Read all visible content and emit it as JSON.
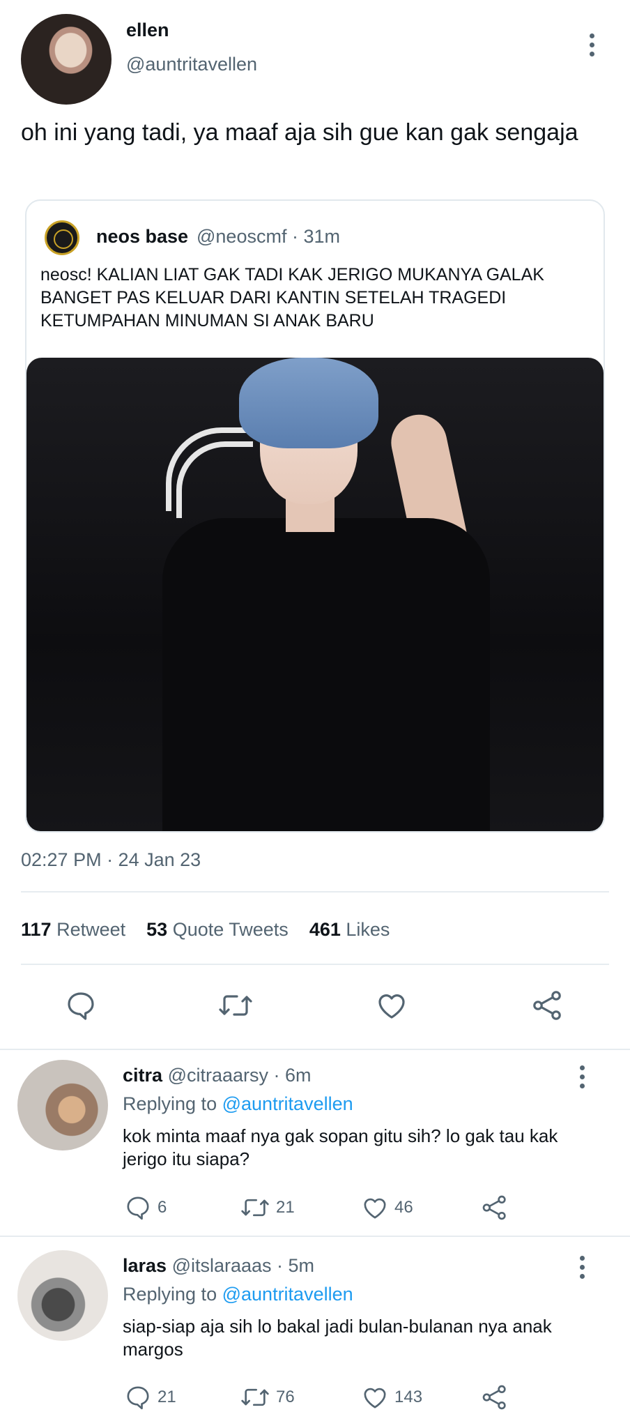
{
  "tweet": {
    "author_name": "ellen",
    "author_handle": "@auntritavellen",
    "text": "oh ini yang tadi, ya maaf aja sih gue kan gak sengaja",
    "timestamp": "02:27 PM · 24 Jan 23",
    "stats": {
      "retweets_count": "117",
      "retweets_label": "Retweet",
      "quotes_count": "53",
      "quotes_label": "Quote Tweets",
      "likes_count": "461",
      "likes_label": "Likes"
    }
  },
  "quote": {
    "name": "neos base",
    "meta": "@neoscmf · 31m",
    "text": "neosc! KALIAN LIAT GAK TADI KAK JERIGO MUKANYA GALAK BANGET PAS KELUAR DARI KANTIN SETELAH TRAGEDI KETUMPAHAN MINUMAN SI ANAK BARU"
  },
  "replies": [
    {
      "name": "citra",
      "meta": "@citraaarsy · 6m",
      "replying_label": "Replying to",
      "replying_to": "@auntritavellen",
      "text": "kok minta maaf nya gak sopan gitu sih? lo gak tau kak jerigo itu siapa?",
      "reply_count": "6",
      "retweet_count": "21",
      "like_count": "46"
    },
    {
      "name": "laras",
      "meta": "@itslaraaas · 5m",
      "replying_label": "Replying to",
      "replying_to": "@auntritavellen",
      "text": "siap-siap aja sih lo bakal jadi bulan-bulanan nya anak margos",
      "reply_count": "21",
      "retweet_count": "76",
      "like_count": "143"
    }
  ],
  "icons": {
    "reply": "comment-icon",
    "retweet": "retweet-icon",
    "like": "heart-icon",
    "share": "share-icon",
    "more": "more-vertical-icon"
  },
  "colors": {
    "link": "#1d9bf0",
    "secondary_text": "#536471",
    "divider": "#e6ecf0"
  }
}
